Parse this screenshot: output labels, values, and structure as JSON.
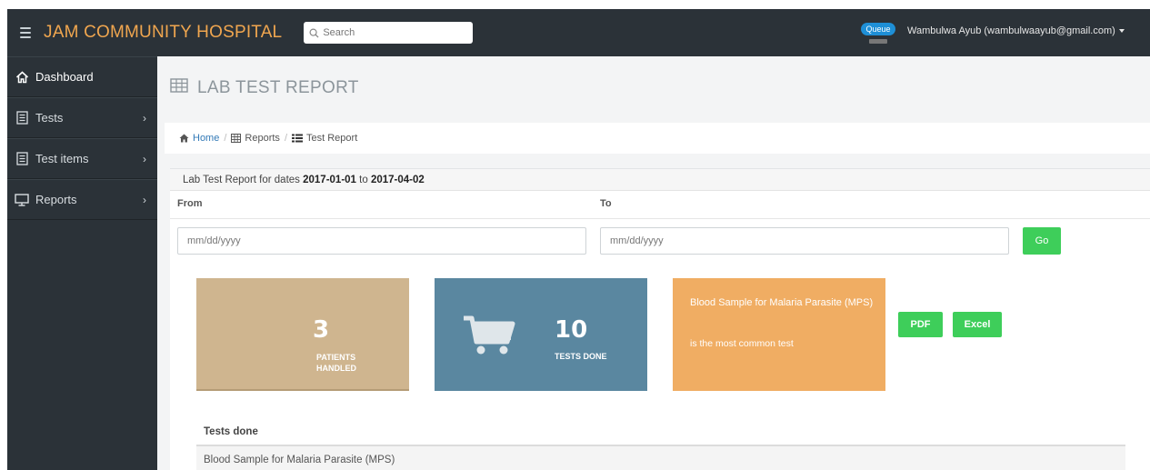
{
  "header": {
    "brand": "JAM COMMUNITY HOSPITAL",
    "search_placeholder": "Search",
    "queue_label": "Queue",
    "user": "Wambulwa Ayub (wambulwaayub@gmail.com)"
  },
  "sidebar": {
    "items": [
      {
        "label": "Dashboard",
        "icon": "home-icon",
        "has_chevron": false
      },
      {
        "label": "Tests",
        "icon": "document-icon",
        "has_chevron": true
      },
      {
        "label": "Test items",
        "icon": "document-icon",
        "has_chevron": true
      },
      {
        "label": "Reports",
        "icon": "monitor-icon",
        "has_chevron": true
      }
    ]
  },
  "page": {
    "title": "LAB TEST REPORT",
    "breadcrumb": {
      "home": "Home",
      "reports": "Reports",
      "current": "Test Report"
    }
  },
  "report": {
    "header_prefix": "Lab Test Report for dates",
    "date_from": "2017-01-01",
    "to_word": "to",
    "date_to": "2017-04-02",
    "from_label": "From",
    "to_label": "To",
    "from_placeholder": "mm/dd/yyyy",
    "to_placeholder": "mm/dd/yyyy",
    "go_label": "Go"
  },
  "stats": {
    "patients_count": "3",
    "patients_label": "PATIENTS HANDLED",
    "tests_count": "10",
    "tests_label": "TESTS DONE",
    "common_test": "Blood Sample for Malaria Parasite (MPS)",
    "common_suffix": "is the most common test"
  },
  "export": {
    "pdf_label": "PDF",
    "excel_label": "Excel"
  },
  "tests_table": {
    "header": "Tests done",
    "rows": [
      "Blood Sample for Malaria Parasite (MPS)"
    ]
  },
  "colors": {
    "topbar": "#2b3238",
    "brand": "#f0a64f",
    "accent_green": "#3ece5a",
    "patients_tile": "#cfb58f",
    "tests_tile": "#5a87a0",
    "common_tile": "#f0ad63",
    "queue_badge": "#1e8fd6"
  }
}
